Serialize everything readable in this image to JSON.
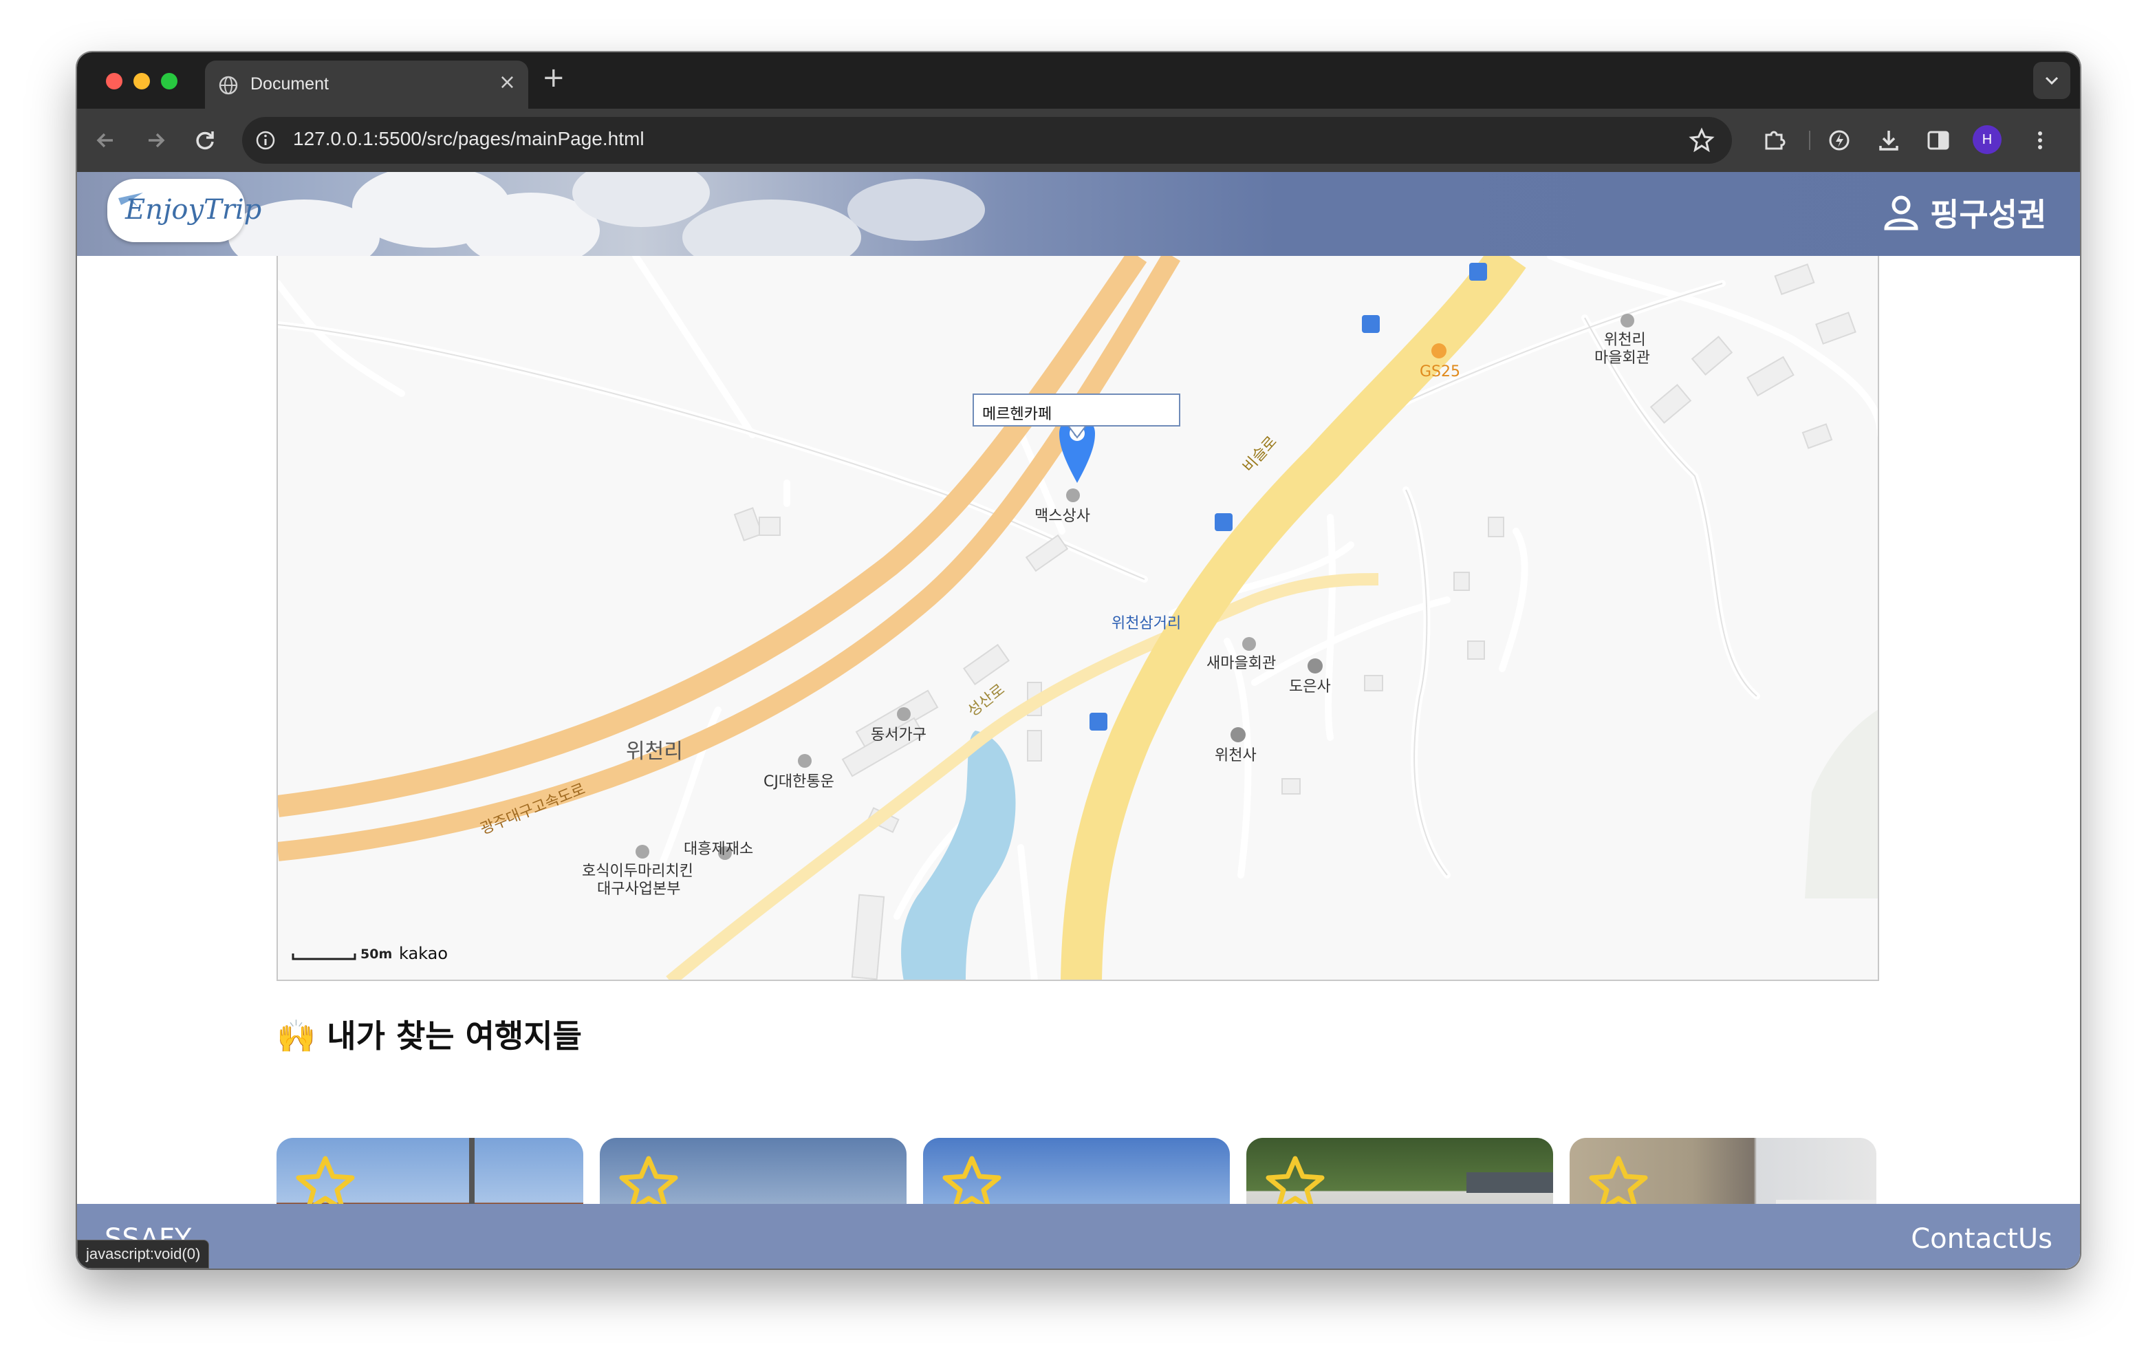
{
  "browser": {
    "tab_title": "Document",
    "tab_close": "×",
    "new_tab": "+",
    "url": "127.0.0.1:5500/src/pages/mainPage.html",
    "profile_initial": "H",
    "status_text": "javascript:void(0)"
  },
  "header": {
    "logo_text": "EnjoyTrip",
    "user_name": "핑구성권"
  },
  "map": {
    "infowindow_text": "메르헨카페",
    "scale_text": "50m",
    "provider": "kakao",
    "labels": {
      "marker_place": "맥스상사",
      "gs25": "GS25",
      "wicheonri_hall_1": "위천리",
      "wicheonri_hall_2": "마을회관",
      "bisulro": "비슬로",
      "wicheon_junction": "위천삼거리",
      "saemaeul": "새마을회관",
      "doeunsa": "도은사",
      "wicheonsa": "위천사",
      "dongseo": "동서가구",
      "seongsanro": "성산로",
      "wicheonri": "위천리",
      "cj": "CJ대한통운",
      "daeheung": "대흥제재소",
      "hosik_1": "호식이두마리치킨",
      "hosik_2": "대구사업본부",
      "expressway": "광주대구고속도로"
    }
  },
  "section": {
    "emoji": "🙌",
    "title": "내가 찾는 여행지들"
  },
  "footer": {
    "left": "SSAFY",
    "right": "ContactUs"
  }
}
